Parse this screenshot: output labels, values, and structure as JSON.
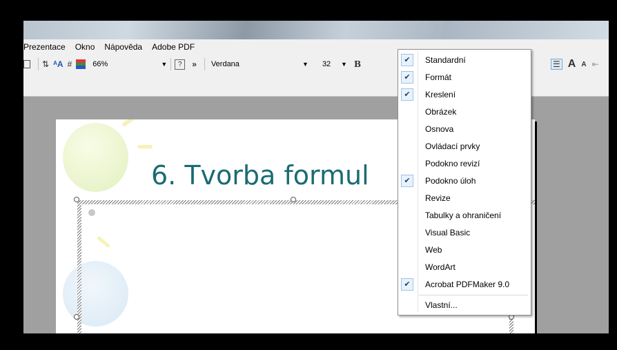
{
  "menu": {
    "items": [
      "Prezentace",
      "Okno",
      "Nápověda",
      "Adobe PDF"
    ]
  },
  "format_toolbar": {
    "zoom": "66%",
    "font_name": "Verdana",
    "font_size": "32",
    "bold_label": "B",
    "overflow_label": "»",
    "font_grow_label": "A",
    "font_shrink_label": "A"
  },
  "slide": {
    "title": "6. Tvorba formul"
  },
  "toolbars_menu": {
    "items": [
      {
        "label": "Standardní",
        "checked": true
      },
      {
        "label": "Formát",
        "checked": true
      },
      {
        "label": "Kreslení",
        "checked": true
      },
      {
        "label": "Obrázek",
        "checked": false
      },
      {
        "label": "Osnova",
        "checked": false
      },
      {
        "label": "Ovládací prvky",
        "checked": false
      },
      {
        "label": "Podokno revizí",
        "checked": false
      },
      {
        "label": "Podokno úloh",
        "checked": true
      },
      {
        "label": "Revize",
        "checked": false
      },
      {
        "label": "Tabulky a ohraničení",
        "checked": false
      },
      {
        "label": "Visual Basic",
        "checked": false
      },
      {
        "label": "Web",
        "checked": false
      },
      {
        "label": "WordArt",
        "checked": false
      },
      {
        "label": "Acrobat PDFMaker 9.0",
        "checked": true
      }
    ],
    "customize_label": "Vlastní..."
  },
  "colors": {
    "title_color": "#1a6b73",
    "check_bg": "#e8f2fc",
    "check_border": "#9ec3e8"
  }
}
